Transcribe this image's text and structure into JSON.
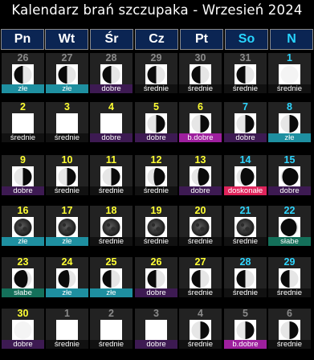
{
  "title": "Kalendarz brań szczupaka - Wrzesień 2024",
  "colors": {
    "background": "#000000",
    "header_bg": "#0b2553",
    "cell_bg": "#222222",
    "day_current": "#ffff33",
    "day_weekend": "#2fd6ff",
    "day_other_month": "#8a8a8a",
    "rating_zle": "#1e8fa0",
    "rating_slabe": "#14705a",
    "rating_srednie": "#111111",
    "rating_dobre": "#3d1a52",
    "rating_bdobre": "#9e1f9e",
    "rating_doskonale": "#e0245c"
  },
  "weekdays": [
    {
      "label": "Pn",
      "weekend": false
    },
    {
      "label": "Wt",
      "weekend": false
    },
    {
      "label": "Śr",
      "weekend": false
    },
    {
      "label": "Cz",
      "weekend": false
    },
    {
      "label": "Pt",
      "weekend": false
    },
    {
      "label": "So",
      "weekend": true
    },
    {
      "label": "N",
      "weekend": true
    }
  ],
  "days": [
    {
      "day": "26",
      "month": "prev",
      "rating": "złe",
      "rating_key": "zle",
      "moon": "waning-crescent-large"
    },
    {
      "day": "27",
      "month": "prev",
      "rating": "złe",
      "rating_key": "zle",
      "moon": "waning-crescent-large"
    },
    {
      "day": "28",
      "month": "prev",
      "rating": "dobre",
      "rating_key": "dobre",
      "moon": "waning-crescent-medium"
    },
    {
      "day": "29",
      "month": "prev",
      "rating": "średnie",
      "rating_key": "srednie",
      "moon": "waning-crescent-thin"
    },
    {
      "day": "30",
      "month": "prev",
      "rating": "średnie",
      "rating_key": "srednie",
      "moon": "waning-crescent-thin"
    },
    {
      "day": "31",
      "month": "prev",
      "rating": "średnie",
      "rating_key": "srednie",
      "moon": "waning-crescent-hair"
    },
    {
      "day": "1",
      "month": "current",
      "rating": "średnie",
      "rating_key": "srednie",
      "moon": "near-new"
    },
    {
      "day": "2",
      "month": "current",
      "rating": "średnie",
      "rating_key": "srednie",
      "moon": "new"
    },
    {
      "day": "3",
      "month": "current",
      "rating": "średnie",
      "rating_key": "srednie",
      "moon": "new"
    },
    {
      "day": "4",
      "month": "current",
      "rating": "dobre",
      "rating_key": "dobre",
      "moon": "new"
    },
    {
      "day": "5",
      "month": "current",
      "rating": "dobre",
      "rating_key": "dobre",
      "moon": "waxing-crescent-hair"
    },
    {
      "day": "6",
      "month": "current",
      "rating": "b.dobre",
      "rating_key": "bdobre",
      "moon": "waxing-crescent-thin"
    },
    {
      "day": "7",
      "month": "current",
      "rating": "dobre",
      "rating_key": "dobre",
      "moon": "waxing-crescent-thin"
    },
    {
      "day": "8",
      "month": "current",
      "rating": "złe",
      "rating_key": "zle",
      "moon": "waxing-crescent-medium"
    },
    {
      "day": "9",
      "month": "current",
      "rating": "dobre",
      "rating_key": "dobre",
      "moon": "waxing-crescent-large"
    },
    {
      "day": "10",
      "month": "current",
      "rating": "średnie",
      "rating_key": "srednie",
      "moon": "waxing-crescent-large"
    },
    {
      "day": "11",
      "month": "current",
      "rating": "średnie",
      "rating_key": "srednie",
      "moon": "first-quarter"
    },
    {
      "day": "12",
      "month": "current",
      "rating": "średnie",
      "rating_key": "srednie",
      "moon": "waxing-gibbous-small"
    },
    {
      "day": "13",
      "month": "current",
      "rating": "dobre",
      "rating_key": "dobre",
      "moon": "waxing-gibbous-small"
    },
    {
      "day": "14",
      "month": "current",
      "rating": "doskonałe",
      "rating_key": "doskonale",
      "moon": "waxing-gibbous"
    },
    {
      "day": "15",
      "month": "current",
      "rating": "dobre",
      "rating_key": "dobre",
      "moon": "waxing-gibbous-large"
    },
    {
      "day": "16",
      "month": "current",
      "rating": "złe",
      "rating_key": "zle",
      "moon": "full"
    },
    {
      "day": "17",
      "month": "current",
      "rating": "złe",
      "rating_key": "zle",
      "moon": "full"
    },
    {
      "day": "18",
      "month": "current",
      "rating": "średnie",
      "rating_key": "srednie",
      "moon": "full"
    },
    {
      "day": "19",
      "month": "current",
      "rating": "średnie",
      "rating_key": "srednie",
      "moon": "full"
    },
    {
      "day": "20",
      "month": "current",
      "rating": "średnie",
      "rating_key": "srednie",
      "moon": "full"
    },
    {
      "day": "21",
      "month": "current",
      "rating": "średnie",
      "rating_key": "srednie",
      "moon": "full"
    },
    {
      "day": "22",
      "month": "current",
      "rating": "słabe",
      "rating_key": "slabe",
      "moon": "waning-gibbous-large"
    },
    {
      "day": "23",
      "month": "current",
      "rating": "słabe",
      "rating_key": "slabe",
      "moon": "waning-gibbous"
    },
    {
      "day": "24",
      "month": "current",
      "rating": "złe",
      "rating_key": "zle",
      "moon": "waning-gibbous-small"
    },
    {
      "day": "25",
      "month": "current",
      "rating": "złe",
      "rating_key": "zle",
      "moon": "last-quarter"
    },
    {
      "day": "26",
      "month": "current",
      "rating": "dobre",
      "rating_key": "dobre",
      "moon": "waning-crescent-large"
    },
    {
      "day": "27",
      "month": "current",
      "rating": "średnie",
      "rating_key": "srednie",
      "moon": "waning-crescent-medium"
    },
    {
      "day": "28",
      "month": "current",
      "rating": "średnie",
      "rating_key": "srednie",
      "moon": "waning-crescent-thin"
    },
    {
      "day": "29",
      "month": "current",
      "rating": "średnie",
      "rating_key": "srednie",
      "moon": "waning-crescent-hair"
    },
    {
      "day": "30",
      "month": "current",
      "rating": "dobre",
      "rating_key": "dobre",
      "moon": "near-new"
    },
    {
      "day": "1",
      "month": "next",
      "rating": "średnie",
      "rating_key": "srednie",
      "moon": "new"
    },
    {
      "day": "2",
      "month": "next",
      "rating": "średnie",
      "rating_key": "srednie",
      "moon": "new"
    },
    {
      "day": "3",
      "month": "next",
      "rating": "dobre",
      "rating_key": "dobre",
      "moon": "new"
    },
    {
      "day": "4",
      "month": "next",
      "rating": "średnie",
      "rating_key": "srednie",
      "moon": "waxing-crescent-hair"
    },
    {
      "day": "5",
      "month": "next",
      "rating": "b.dobre",
      "rating_key": "bdobre",
      "moon": "waxing-crescent-thin"
    },
    {
      "day": "6",
      "month": "next",
      "rating": "średnie",
      "rating_key": "srednie",
      "moon": "waxing-crescent-thin"
    }
  ]
}
